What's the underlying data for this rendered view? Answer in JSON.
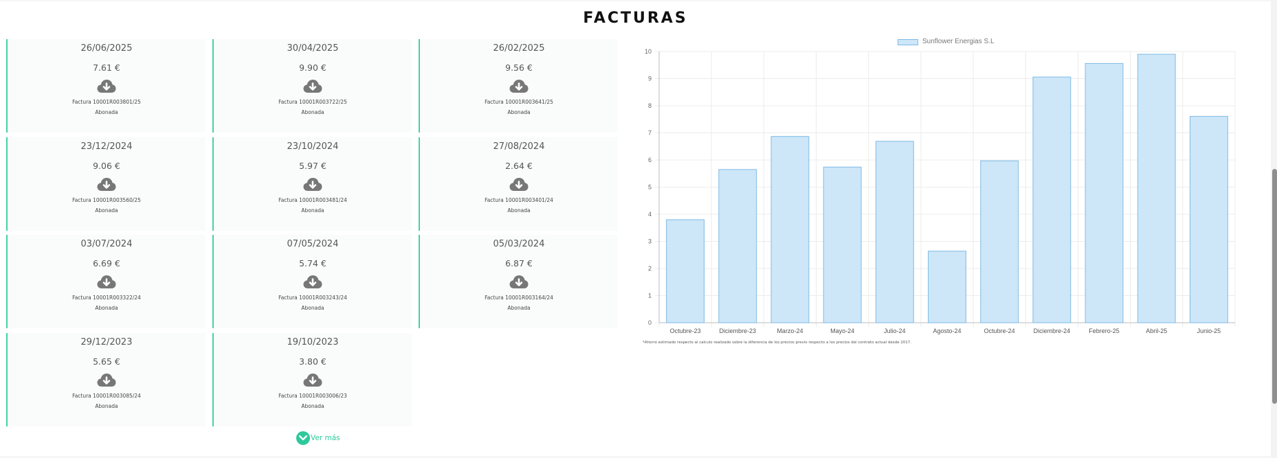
{
  "title": "FACTURAS",
  "invoices": [
    {
      "date": "26/06/2025",
      "amount": "7.61 €",
      "number": "Factura 10001R003801/25",
      "status": "Abonada"
    },
    {
      "date": "30/04/2025",
      "amount": "9.90 €",
      "number": "Factura 10001R003722/25",
      "status": "Abonada"
    },
    {
      "date": "26/02/2025",
      "amount": "9.56 €",
      "number": "Factura 10001R003641/25",
      "status": "Abonada"
    },
    {
      "date": "23/12/2024",
      "amount": "9.06 €",
      "number": "Factura 10001R003560/25",
      "status": "Abonada"
    },
    {
      "date": "23/10/2024",
      "amount": "5.97 €",
      "number": "Factura 10001R003481/24",
      "status": "Abonada"
    },
    {
      "date": "27/08/2024",
      "amount": "2.64 €",
      "number": "Factura 10001R003401/24",
      "status": "Abonada"
    },
    {
      "date": "03/07/2024",
      "amount": "6.69 €",
      "number": "Factura 10001R003322/24",
      "status": "Abonada"
    },
    {
      "date": "07/05/2024",
      "amount": "5.74 €",
      "number": "Factura 10001R003243/24",
      "status": "Abonada"
    },
    {
      "date": "05/03/2024",
      "amount": "6.87 €",
      "number": "Factura 10001R003164/24",
      "status": "Abonada"
    },
    {
      "date": "29/12/2023",
      "amount": "5.65 €",
      "number": "Factura 10001R003085/24",
      "status": "Abonada"
    },
    {
      "date": "19/10/2023",
      "amount": "3.80 €",
      "number": "Factura 10001R003006/23",
      "status": "Abonada"
    }
  ],
  "more_label": "Ver más",
  "icons": {
    "download": "cloud-download-icon",
    "more": "chevron-down-icon"
  },
  "colors": {
    "accent": "#42d2a5",
    "bar_fill": "#cde6f8",
    "bar_border": "#7fbbe5"
  },
  "chart_data": {
    "type": "bar",
    "categories": [
      "Octubre-23",
      "Diciembre-23",
      "Marzo-24",
      "Mayo-24",
      "Julio-24",
      "Agosto-24",
      "Octubre-24",
      "Diciembre-24",
      "Febrero-25",
      "Abril-25",
      "Junio-25"
    ],
    "series": [
      {
        "name": "Sunflower Energias S.L",
        "values": [
          3.8,
          5.65,
          6.87,
          5.74,
          6.69,
          2.64,
          5.97,
          9.06,
          9.56,
          9.9,
          7.61
        ]
      }
    ],
    "ylim": [
      0,
      10
    ],
    "yticks": [
      "0",
      "1",
      "2",
      "3",
      "4",
      "5",
      "6",
      "7",
      "8",
      "9",
      "10"
    ],
    "grid": true,
    "legend": "top-center",
    "footnote": "*Ahorro estimado respecto al calculo realizado sobre la diferencia de los precios previo respecto a los precios del contrato actual desde 2017."
  }
}
